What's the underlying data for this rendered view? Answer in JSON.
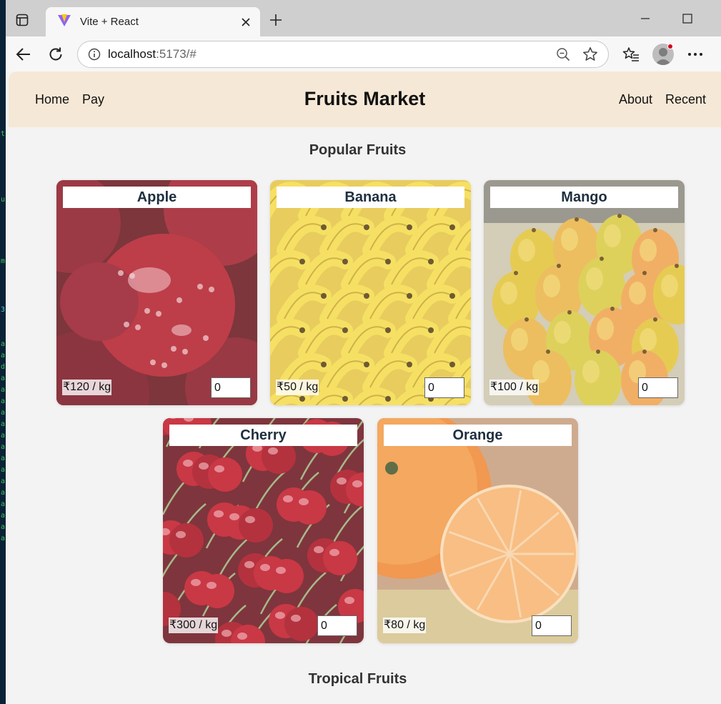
{
  "browser": {
    "tab_title": "Vite + React",
    "url_host": "localhost",
    "url_rest": ":5173/#"
  },
  "site": {
    "nav_left": [
      "Home",
      "Pay"
    ],
    "brand": "Fruits Market",
    "nav_right": [
      "About",
      "Recent"
    ]
  },
  "sections": {
    "popular": "Popular Fruits",
    "tropical": "Tropical Fruits"
  },
  "fruits": [
    {
      "name": "Apple",
      "price": "₹120 / kg",
      "qty": "0",
      "theme": "apple",
      "color": "#b8202c"
    },
    {
      "name": "Banana",
      "price": "₹50 / kg",
      "qty": "0",
      "theme": "banana",
      "color": "#f2d23a"
    },
    {
      "name": "Mango",
      "price": "₹100 / kg",
      "qty": "0",
      "theme": "mango",
      "color": "#e7c640"
    },
    {
      "name": "Cherry",
      "price": "₹300 / kg",
      "qty": "0",
      "theme": "cherry",
      "color": "#c3172b"
    },
    {
      "name": "Orange",
      "price": "₹80 / kg",
      "qty": "0",
      "theme": "orange",
      "color": "#f1a45a"
    }
  ],
  "icons": {
    "tab_actions": "tab-actions-icon",
    "favicon": "vite-logo-icon",
    "close": "close-icon",
    "new_tab": "plus-icon",
    "minimize": "minimize-icon",
    "maximize": "maximize-icon",
    "back": "back-arrow-icon",
    "refresh": "refresh-icon",
    "site_info": "info-icon",
    "zoom": "zoom-out-icon",
    "favorite": "star-icon",
    "favorites": "favorites-icon",
    "profile": "profile-avatar-icon",
    "more": "more-icon"
  }
}
